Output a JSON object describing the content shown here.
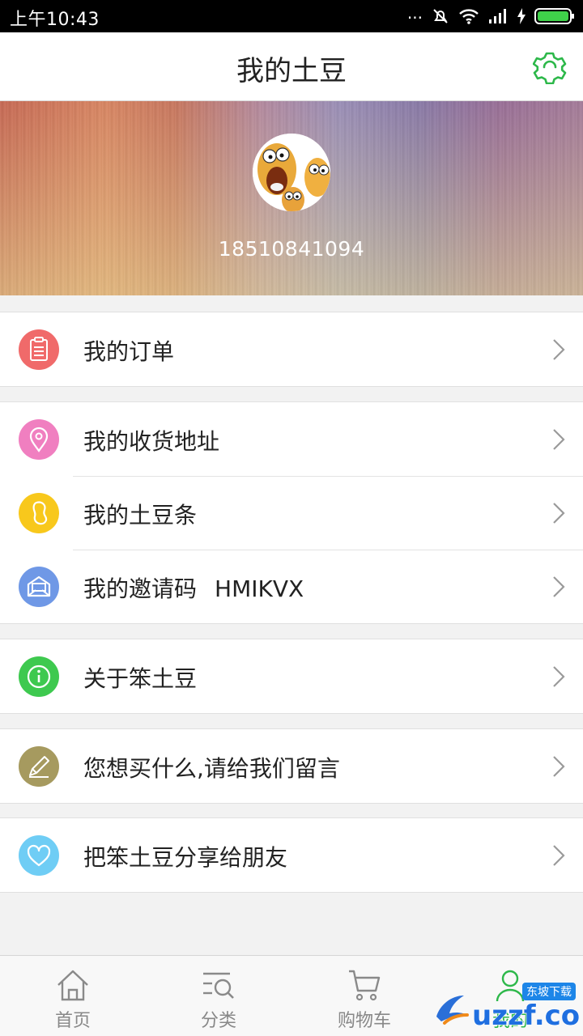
{
  "status_bar": {
    "time": "上午10:43",
    "dots": "...",
    "icons": [
      "mute-icon",
      "wifi-icon",
      "signal-icon",
      "charging-icon",
      "battery-icon"
    ]
  },
  "header": {
    "title": "我的土豆",
    "settings_icon": "settings-gear-icon"
  },
  "profile": {
    "phone": "18510841094",
    "avatar": "cartoon-potato-avatar"
  },
  "menu": {
    "orders": {
      "label": "我的订单",
      "icon": "order-icon",
      "color": "#f06a6a"
    },
    "address": {
      "label": "我的收货地址",
      "icon": "location-pin-icon",
      "color": "#f07fc0"
    },
    "coupons": {
      "label": "我的土豆条",
      "icon": "potato-icon",
      "color": "#f8c81c"
    },
    "invite": {
      "label": "我的邀请码",
      "code": "HMIKVX",
      "icon": "invite-envelope-icon",
      "color": "#6f98e6"
    },
    "about": {
      "label": "关于笨土豆",
      "icon": "info-icon",
      "color": "#3ec94f"
    },
    "feedback": {
      "label": "您想买什么,请给我们留言",
      "icon": "pencil-icon",
      "color": "#a69a5f"
    },
    "share": {
      "label": "把笨土豆分享给朋友",
      "icon": "heart-icon",
      "color": "#6fcdf5"
    }
  },
  "tabbar": {
    "home": "首页",
    "category": "分类",
    "cart": "购物车",
    "me": "我的",
    "active_color": "#2db84a"
  },
  "watermark": {
    "text": "uzzf.com",
    "tag": "东坡下载"
  }
}
